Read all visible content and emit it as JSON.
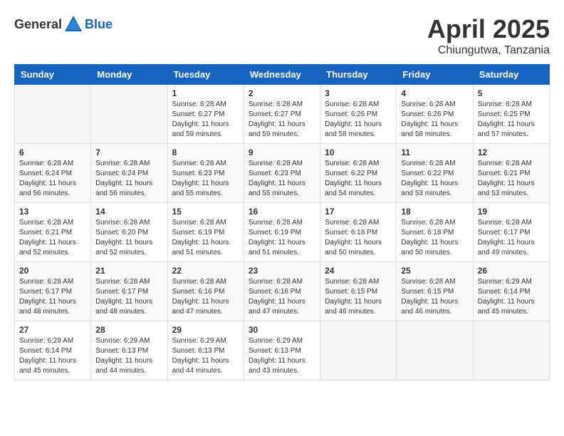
{
  "header": {
    "logo_general": "General",
    "logo_blue": "Blue",
    "title": "April 2025",
    "location": "Chiungutwa, Tanzania"
  },
  "calendar": {
    "days_of_week": [
      "Sunday",
      "Monday",
      "Tuesday",
      "Wednesday",
      "Thursday",
      "Friday",
      "Saturday"
    ],
    "weeks": [
      [
        {
          "day": "",
          "info": ""
        },
        {
          "day": "",
          "info": ""
        },
        {
          "day": "1",
          "info": "Sunrise: 6:28 AM\nSunset: 6:27 PM\nDaylight: 11 hours and 59 minutes."
        },
        {
          "day": "2",
          "info": "Sunrise: 6:28 AM\nSunset: 6:27 PM\nDaylight: 11 hours and 59 minutes."
        },
        {
          "day": "3",
          "info": "Sunrise: 6:28 AM\nSunset: 6:26 PM\nDaylight: 11 hours and 58 minutes."
        },
        {
          "day": "4",
          "info": "Sunrise: 6:28 AM\nSunset: 6:26 PM\nDaylight: 11 hours and 58 minutes."
        },
        {
          "day": "5",
          "info": "Sunrise: 6:28 AM\nSunset: 6:25 PM\nDaylight: 11 hours and 57 minutes."
        }
      ],
      [
        {
          "day": "6",
          "info": "Sunrise: 6:28 AM\nSunset: 6:24 PM\nDaylight: 11 hours and 56 minutes."
        },
        {
          "day": "7",
          "info": "Sunrise: 6:28 AM\nSunset: 6:24 PM\nDaylight: 11 hours and 56 minutes."
        },
        {
          "day": "8",
          "info": "Sunrise: 6:28 AM\nSunset: 6:23 PM\nDaylight: 11 hours and 55 minutes."
        },
        {
          "day": "9",
          "info": "Sunrise: 6:28 AM\nSunset: 6:23 PM\nDaylight: 11 hours and 55 minutes."
        },
        {
          "day": "10",
          "info": "Sunrise: 6:28 AM\nSunset: 6:22 PM\nDaylight: 11 hours and 54 minutes."
        },
        {
          "day": "11",
          "info": "Sunrise: 6:28 AM\nSunset: 6:22 PM\nDaylight: 11 hours and 53 minutes."
        },
        {
          "day": "12",
          "info": "Sunrise: 6:28 AM\nSunset: 6:21 PM\nDaylight: 11 hours and 53 minutes."
        }
      ],
      [
        {
          "day": "13",
          "info": "Sunrise: 6:28 AM\nSunset: 6:21 PM\nDaylight: 11 hours and 52 minutes."
        },
        {
          "day": "14",
          "info": "Sunrise: 6:28 AM\nSunset: 6:20 PM\nDaylight: 11 hours and 52 minutes."
        },
        {
          "day": "15",
          "info": "Sunrise: 6:28 AM\nSunset: 6:19 PM\nDaylight: 11 hours and 51 minutes."
        },
        {
          "day": "16",
          "info": "Sunrise: 6:28 AM\nSunset: 6:19 PM\nDaylight: 11 hours and 51 minutes."
        },
        {
          "day": "17",
          "info": "Sunrise: 6:28 AM\nSunset: 6:18 PM\nDaylight: 11 hours and 50 minutes."
        },
        {
          "day": "18",
          "info": "Sunrise: 6:28 AM\nSunset: 6:18 PM\nDaylight: 11 hours and 50 minutes."
        },
        {
          "day": "19",
          "info": "Sunrise: 6:28 AM\nSunset: 6:17 PM\nDaylight: 11 hours and 49 minutes."
        }
      ],
      [
        {
          "day": "20",
          "info": "Sunrise: 6:28 AM\nSunset: 6:17 PM\nDaylight: 11 hours and 48 minutes."
        },
        {
          "day": "21",
          "info": "Sunrise: 6:28 AM\nSunset: 6:17 PM\nDaylight: 11 hours and 48 minutes."
        },
        {
          "day": "22",
          "info": "Sunrise: 6:28 AM\nSunset: 6:16 PM\nDaylight: 11 hours and 47 minutes."
        },
        {
          "day": "23",
          "info": "Sunrise: 6:28 AM\nSunset: 6:16 PM\nDaylight: 11 hours and 47 minutes."
        },
        {
          "day": "24",
          "info": "Sunrise: 6:28 AM\nSunset: 6:15 PM\nDaylight: 11 hours and 46 minutes."
        },
        {
          "day": "25",
          "info": "Sunrise: 6:28 AM\nSunset: 6:15 PM\nDaylight: 11 hours and 46 minutes."
        },
        {
          "day": "26",
          "info": "Sunrise: 6:29 AM\nSunset: 6:14 PM\nDaylight: 11 hours and 45 minutes."
        }
      ],
      [
        {
          "day": "27",
          "info": "Sunrise: 6:29 AM\nSunset: 6:14 PM\nDaylight: 11 hours and 45 minutes."
        },
        {
          "day": "28",
          "info": "Sunrise: 6:29 AM\nSunset: 6:13 PM\nDaylight: 11 hours and 44 minutes."
        },
        {
          "day": "29",
          "info": "Sunrise: 6:29 AM\nSunset: 6:13 PM\nDaylight: 11 hours and 44 minutes."
        },
        {
          "day": "30",
          "info": "Sunrise: 6:29 AM\nSunset: 6:13 PM\nDaylight: 11 hours and 43 minutes."
        },
        {
          "day": "",
          "info": ""
        },
        {
          "day": "",
          "info": ""
        },
        {
          "day": "",
          "info": ""
        }
      ]
    ]
  }
}
